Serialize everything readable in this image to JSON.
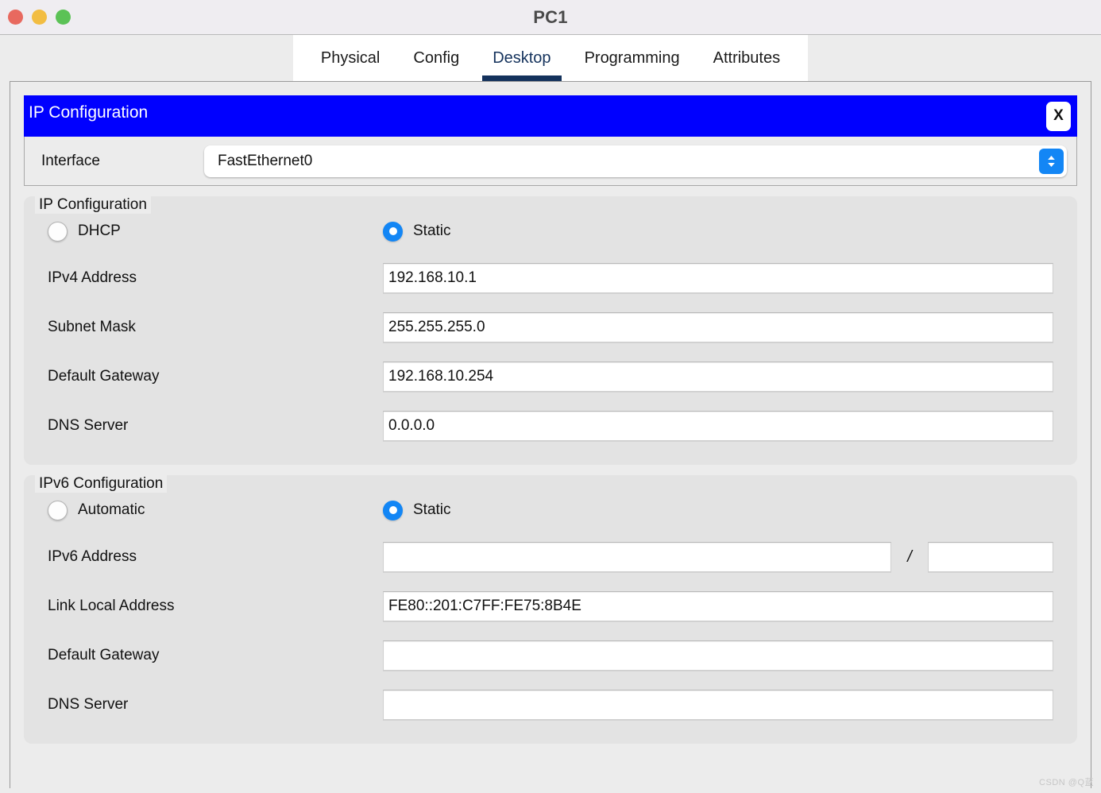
{
  "window": {
    "title": "PC1",
    "traffic_lights": [
      {
        "name": "close",
        "color": "#e8695f"
      },
      {
        "name": "minimize",
        "color": "#f2bd42"
      },
      {
        "name": "maximize",
        "color": "#5bc256"
      }
    ]
  },
  "tabs": [
    {
      "label": "Physical",
      "active": false
    },
    {
      "label": "Config",
      "active": false
    },
    {
      "label": "Desktop",
      "active": true
    },
    {
      "label": "Programming",
      "active": false
    },
    {
      "label": "Attributes",
      "active": false
    }
  ],
  "dialog": {
    "title": "IP Configuration",
    "title_bar_color": "#0000ff",
    "close_label": "X"
  },
  "interface": {
    "label": "Interface",
    "value": "FastEthernet0",
    "stepper_icon": "chevron-up-down-icon"
  },
  "ipv4": {
    "legend": "IP Configuration",
    "mode_options": [
      {
        "label": "DHCP",
        "selected": false
      },
      {
        "label": "Static",
        "selected": true
      }
    ],
    "fields": [
      {
        "label": "IPv4 Address",
        "value": "192.168.10.1"
      },
      {
        "label": "Subnet Mask",
        "value": "255.255.255.0"
      },
      {
        "label": "Default Gateway",
        "value": "192.168.10.254"
      },
      {
        "label": "DNS Server",
        "value": "0.0.0.0"
      }
    ]
  },
  "ipv6": {
    "legend": "IPv6 Configuration",
    "mode_options": [
      {
        "label": "Automatic",
        "selected": false
      },
      {
        "label": "Static",
        "selected": true
      }
    ],
    "address_row": {
      "label": "IPv6 Address",
      "value": "",
      "separator": "/",
      "prefix_value": ""
    },
    "fields": [
      {
        "label": "Link Local Address",
        "value": "FE80::201:C7FF:FE75:8B4E"
      },
      {
        "label": "Default Gateway",
        "value": ""
      },
      {
        "label": "DNS Server",
        "value": ""
      }
    ]
  },
  "watermark": "CSDN @Q蓝",
  "colors": {
    "accent_blue": "#1386f5",
    "dialog_blue": "#0000ff",
    "active_tab": "#14325c",
    "window_bg": "#ececec",
    "group_bg": "#e3e3e3"
  }
}
